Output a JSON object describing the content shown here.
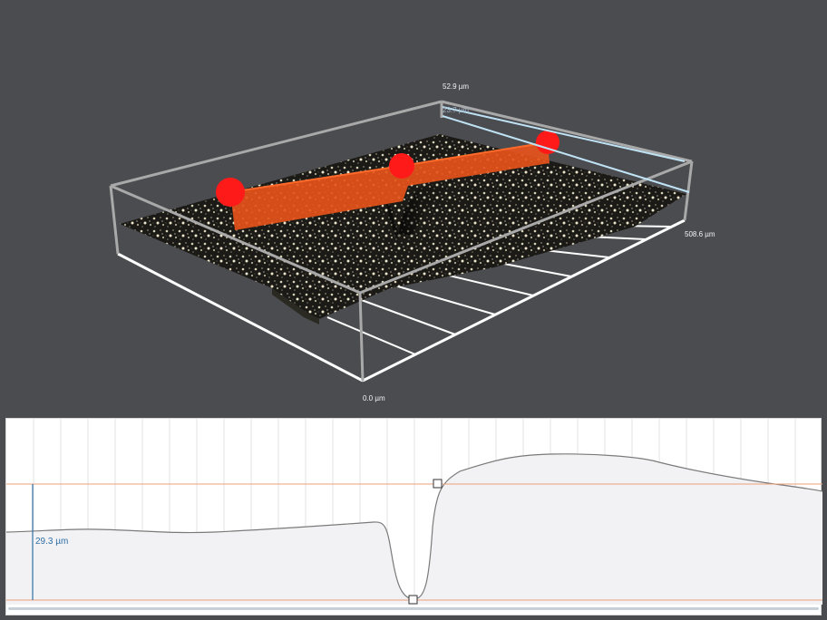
{
  "viewer3d": {
    "z_max_label": "52.9 µm",
    "z_mid_label": "23.7 µm",
    "y_max_label": "508.6 µm",
    "origin_label": "0.0 µm",
    "profile_color": "#e5531b",
    "marker_color": "#ff1a1a",
    "marker_count": 3
  },
  "profile": {
    "height_label": "29.3 µm",
    "reference_line_color": "#e9a07a",
    "cursor_color": "#2e6fa5",
    "fill_color": "#f2f2f4",
    "curve_color": "#7a7a7a"
  }
}
